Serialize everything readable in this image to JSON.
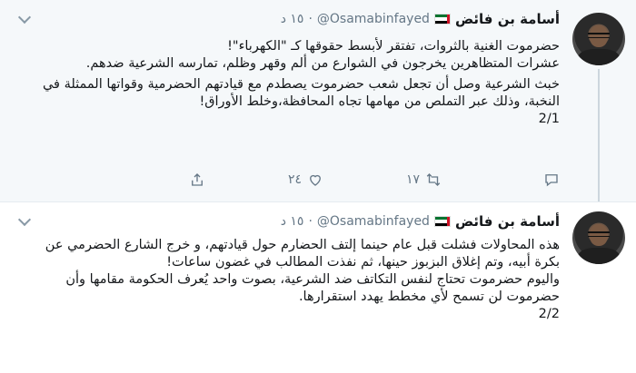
{
  "tweets": [
    {
      "author_name": "أسامة بن فائض",
      "handle": "@Osamabinfayed",
      "separator": "·",
      "time": "١٥ د",
      "lines": [
        "حضرموت الغنية بالثروات، تفتقر لأبسط حقوقها كـ \"الكهرباء\"!",
        "عشرات المتظاهرين يخرجون في الشوارع من ألم وقهر وظلم، تمارسه الشرعية ضدهم.",
        "خبث الشرعية وصل أن تجعل شعب حضرموت يصطدم مع قيادتهم الحضرمية وقواتها الممثلة في النخبة، وذلك عبر التملص من مهامها تجاه المحافظة،وخلط الأوراق!",
        "2/1"
      ],
      "reply_count": "",
      "retweet_count": "١٧",
      "like_count": "٢٤"
    },
    {
      "author_name": "أسامة بن فائض",
      "handle": "@Osamabinfayed",
      "separator": "·",
      "time": "١٥ د",
      "lines": [
        "هذه المحاولات فشلت قبل عام حينما إلتف الحضارم حول قيادتهم، و خرج الشارع الحضرمي عن بكرة أبيه، وتم إغلاق البزبوز حينها، ثم نفذت المطالب في غضون ساعات!",
        "واليوم حضرموت تحتاج لنفس التكاتف ضد الشرعية، بصوت واحد يُعرف الحكومة مقامها وأن حضرموت لن تسمح لأي مخطط يهدد استقرارها.",
        "2/2"
      ]
    }
  ],
  "colors": {
    "selected_background": "#f5f8fa",
    "text": "#14171a",
    "muted": "#657786",
    "thread_line": "#ccd6dd"
  },
  "icons": [
    "chevron-down-icon",
    "reply-icon",
    "retweet-icon",
    "like-icon",
    "share-icon",
    "uae-flag-icon"
  ]
}
